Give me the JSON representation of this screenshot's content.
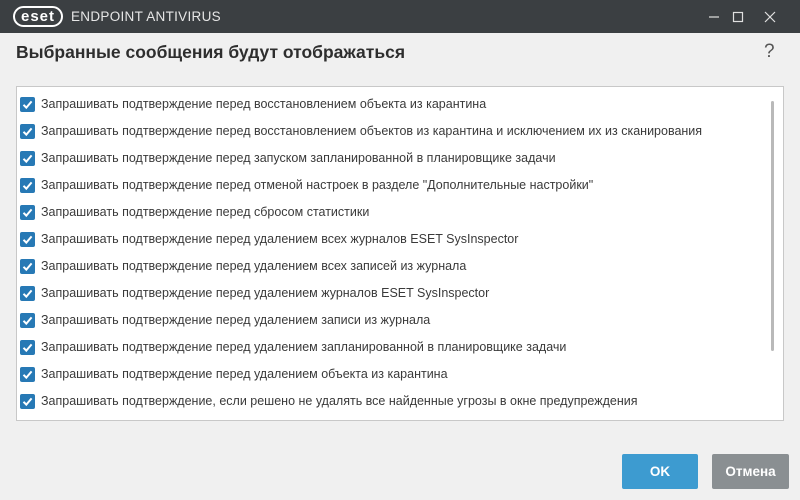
{
  "window": {
    "logo_text": "eset",
    "app_title": "ENDPOINT ANTIVIRUS",
    "icons": [
      "minimize-icon",
      "maximize-icon",
      "close-icon"
    ]
  },
  "dialog": {
    "heading": "Выбранные сообщения будут отображаться",
    "help_label": "?"
  },
  "items": [
    {
      "label": "Запрашивать подтверждение перед восстановлением объекта из карантина",
      "checked": true
    },
    {
      "label": "Запрашивать подтверждение перед восстановлением объектов из карантина и исключением их из сканирования",
      "checked": true
    },
    {
      "label": "Запрашивать подтверждение перед запуском запланированной в планировщике задачи",
      "checked": true
    },
    {
      "label": "Запрашивать подтверждение перед отменой настроек в разделе \"Дополнительные настройки\"",
      "checked": true
    },
    {
      "label": "Запрашивать подтверждение перед сбросом статистики",
      "checked": true
    },
    {
      "label": "Запрашивать подтверждение перед удалением всех журналов ESET SysInspector",
      "checked": true
    },
    {
      "label": "Запрашивать подтверждение перед удалением всех записей из журнала",
      "checked": true
    },
    {
      "label": "Запрашивать подтверждение перед удалением журналов ESET SysInspector",
      "checked": true
    },
    {
      "label": "Запрашивать подтверждение перед удалением записи из журнала",
      "checked": true
    },
    {
      "label": "Запрашивать подтверждение перед удалением запланированной в планировщике задачи",
      "checked": true
    },
    {
      "label": "Запрашивать подтверждение перед удалением объекта из карантина",
      "checked": true
    },
    {
      "label": "Запрашивать подтверждение, если решено не удалять все найденные угрозы в окне предупреждения",
      "checked": true
    },
    {
      "label": "",
      "checked": true
    }
  ],
  "buttons": {
    "ok_label": "OK",
    "cancel_label": "Отмена"
  },
  "colors": {
    "titlebar": "#3b3f42",
    "checkbox": "#2779b5",
    "ok_button": "#3d9bd0",
    "cancel_button": "#8a8f92"
  }
}
